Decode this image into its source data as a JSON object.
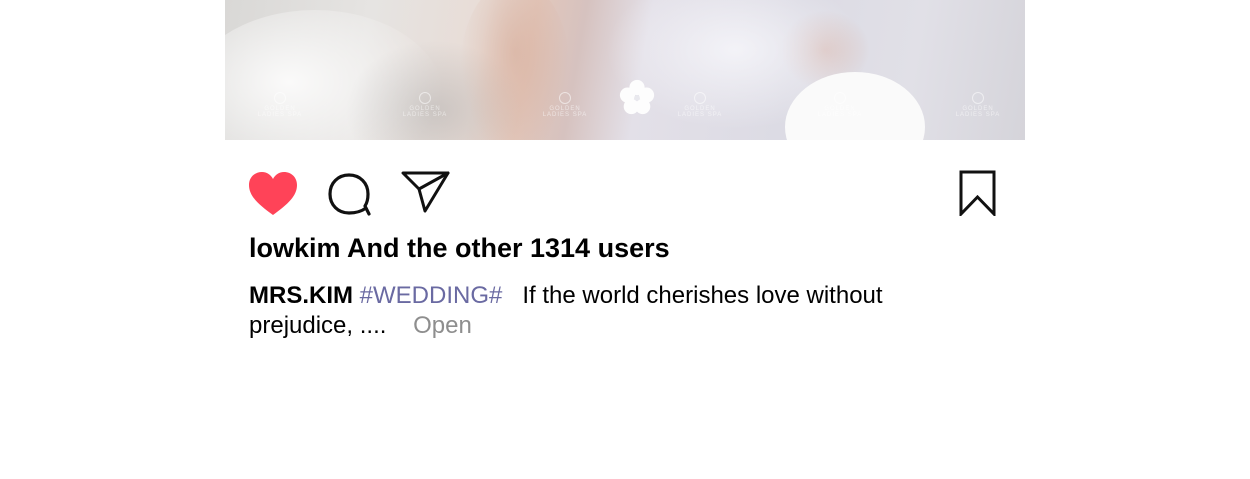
{
  "post": {
    "likes_text": "lowkim And the other 1314 users",
    "caption": {
      "author": "MRS.KIM",
      "hashtag": "#WEDDING#",
      "text": "If the world cherishes love without prejudice, ....",
      "more_label": "Open"
    },
    "photo_watermark": "GOLDEN LADIES SPA",
    "icons": {
      "like": "heart-filled-icon",
      "comment": "comment-bubble-icon",
      "share": "paper-plane-icon",
      "save": "bookmark-icon"
    }
  },
  "colors": {
    "like": "#ff4358",
    "hashtag": "#6a6aa2",
    "muted": "#8e8e8e",
    "text": "#000000"
  }
}
